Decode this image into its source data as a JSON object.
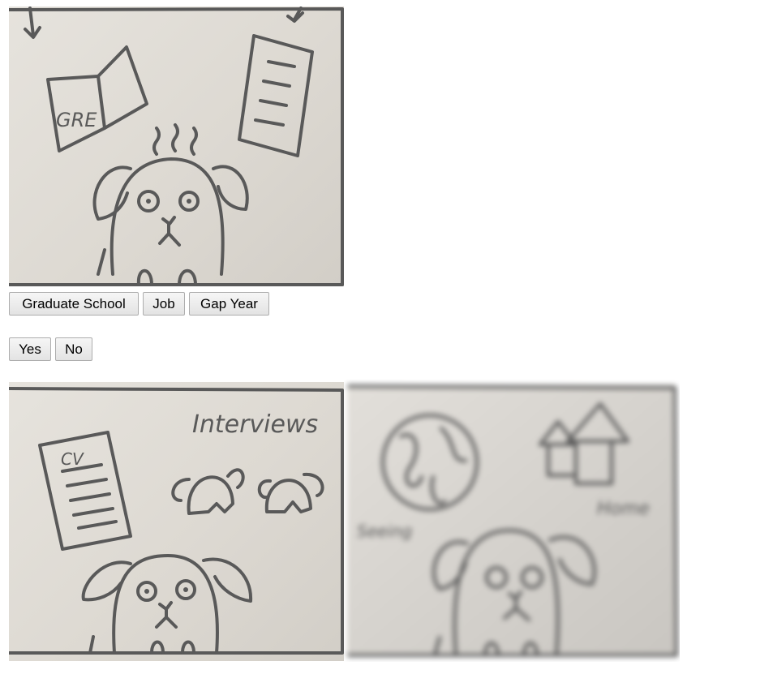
{
  "question_one": {
    "image": {
      "alt": "dog thinking about GRE and CV"
    },
    "options": [
      {
        "label": "Graduate School"
      },
      {
        "label": "Job"
      },
      {
        "label": "Gap Year"
      }
    ]
  },
  "question_two": {
    "options": [
      {
        "label": "Yes"
      },
      {
        "label": "No"
      }
    ]
  },
  "results": {
    "job_image": {
      "cv_text": "CV",
      "interviews_text": "Interviews"
    },
    "gap_year_image": {
      "left_text": "Seeing",
      "right_text": "Home",
      "blurred": true
    }
  }
}
